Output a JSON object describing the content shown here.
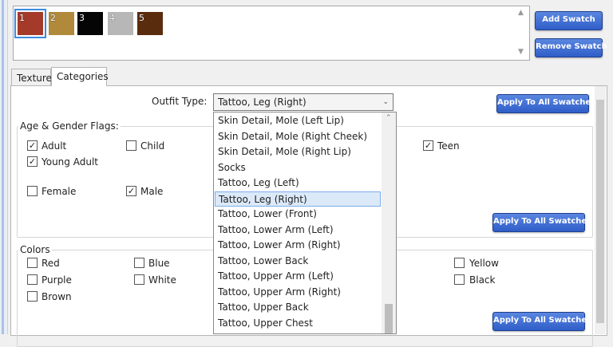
{
  "swatches": [
    {
      "label": "1",
      "color": "#a33a2a",
      "selected": true
    },
    {
      "label": "2",
      "color": "#b08a3a",
      "selected": false
    },
    {
      "label": "3",
      "color": "#050505",
      "selected": false
    },
    {
      "label": "4",
      "color": "#b7b7b7",
      "selected": false
    },
    {
      "label": "5",
      "color": "#5a2c0e",
      "selected": false
    }
  ],
  "buttons": {
    "add_swatch": "Add Swatch",
    "remove_swatch": "Remove Swatch",
    "apply_all_1": "Apply To All Swatches",
    "apply_all_2": "Apply To All Swatches",
    "apply_all_3": "Apply To All Swatches"
  },
  "tabs": [
    {
      "label": "Texture",
      "active": false
    },
    {
      "label": "Categories",
      "active": true
    }
  ],
  "outfit_type": {
    "label": "Outfit Type:",
    "value": "Tattoo, Leg (Right)"
  },
  "age_gender": {
    "title": "Age & Gender Flags:",
    "flags": [
      {
        "label": "Adult",
        "checked": true
      },
      {
        "label": "Child",
        "checked": false
      },
      {
        "label": "Teen",
        "checked": true
      },
      {
        "label": "Young Adult",
        "checked": true
      },
      {
        "label": "Female",
        "checked": false
      },
      {
        "label": "Male",
        "checked": true
      }
    ]
  },
  "colors": {
    "title": "Colors",
    "items": [
      {
        "label": "Red",
        "checked": false
      },
      {
        "label": "Blue",
        "checked": false
      },
      {
        "label": "Yellow",
        "checked": false
      },
      {
        "label": "Purple",
        "checked": false
      },
      {
        "label": "White",
        "checked": false
      },
      {
        "label": "Black",
        "checked": false
      },
      {
        "label": "Brown",
        "checked": false
      }
    ]
  },
  "dropdown": {
    "items": [
      "Skin Detail, Mole (Left Lip)",
      "Skin Detail, Mole (Right Cheek)",
      "Skin Detail, Mole (Right Lip)",
      "Socks",
      "Tattoo, Leg (Left)",
      "Tattoo, Leg (Right)",
      "Tattoo, Lower (Front)",
      "Tattoo, Lower Arm (Left)",
      "Tattoo, Lower Arm (Right)",
      "Tattoo, Lower Back",
      "Tattoo, Upper Arm (Left)",
      "Tattoo, Upper Arm (Right)",
      "Tattoo, Upper Back",
      "Tattoo, Upper Chest"
    ],
    "selected_index": 5
  },
  "icons": {
    "combo_arrow": "chevron-down-icon",
    "checkmark": "check-icon"
  }
}
